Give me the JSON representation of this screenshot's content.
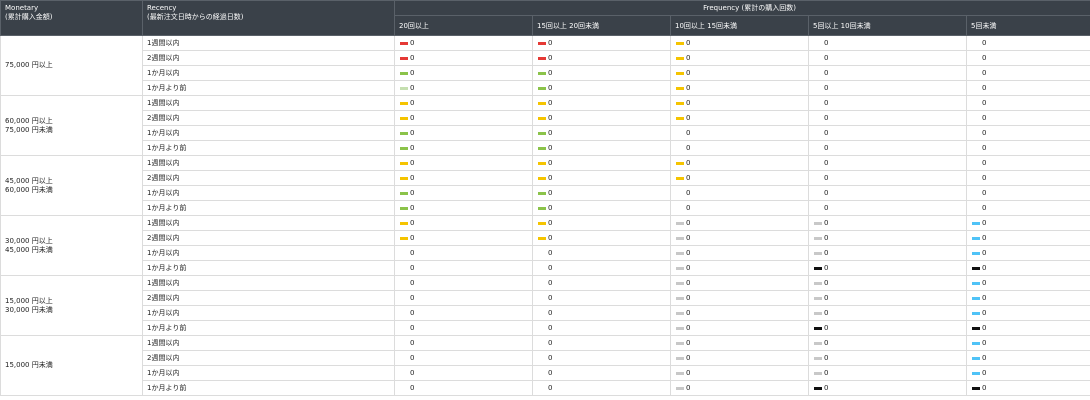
{
  "header": {
    "monetary": "Monetary",
    "monetary_sub": "(累計購入金額)",
    "recency": "Recency",
    "recency_sub": "(最新注文日時からの経過日数)",
    "frequency": "Frequency (累計の購入回数)",
    "bands": [
      "20回以上",
      "15回以上 20回未満",
      "10回以上 15回未満",
      "5回以上 10回未満",
      "5回未満"
    ]
  },
  "recency_labels": [
    "1週間以内",
    "2週間以内",
    "1か月以内",
    "1か月より前"
  ],
  "colors": {
    "red": "#e53935",
    "yellow": "#f5c400",
    "green": "#8bc34a",
    "lightgreen": "#c5dfb0",
    "grey": "#c8c8c8",
    "blue": "#4fc3f7",
    "black": "#111111"
  },
  "groups": [
    {
      "monetary": [
        "75,000 円以上"
      ],
      "rows": [
        {
          "cells": [
            {
              "v": "0",
              "c": "red"
            },
            {
              "v": "0",
              "c": "red"
            },
            {
              "v": "0",
              "c": "yellow"
            },
            {
              "v": "0",
              "c": ""
            },
            {
              "v": "0",
              "c": ""
            }
          ]
        },
        {
          "cells": [
            {
              "v": "0",
              "c": "red"
            },
            {
              "v": "0",
              "c": "red"
            },
            {
              "v": "0",
              "c": "yellow"
            },
            {
              "v": "0",
              "c": ""
            },
            {
              "v": "0",
              "c": ""
            }
          ]
        },
        {
          "cells": [
            {
              "v": "0",
              "c": "green"
            },
            {
              "v": "0",
              "c": "green"
            },
            {
              "v": "0",
              "c": "yellow"
            },
            {
              "v": "0",
              "c": ""
            },
            {
              "v": "0",
              "c": ""
            }
          ]
        },
        {
          "cells": [
            {
              "v": "0",
              "c": "lightgreen"
            },
            {
              "v": "0",
              "c": "green"
            },
            {
              "v": "0",
              "c": "yellow"
            },
            {
              "v": "0",
              "c": ""
            },
            {
              "v": "0",
              "c": ""
            }
          ]
        }
      ]
    },
    {
      "monetary": [
        "60,000 円以上",
        "75,000 円未満"
      ],
      "rows": [
        {
          "cells": [
            {
              "v": "0",
              "c": "yellow"
            },
            {
              "v": "0",
              "c": "yellow"
            },
            {
              "v": "0",
              "c": "yellow"
            },
            {
              "v": "0",
              "c": ""
            },
            {
              "v": "0",
              "c": ""
            }
          ]
        },
        {
          "cells": [
            {
              "v": "0",
              "c": "yellow"
            },
            {
              "v": "0",
              "c": "yellow"
            },
            {
              "v": "0",
              "c": "yellow"
            },
            {
              "v": "0",
              "c": ""
            },
            {
              "v": "0",
              "c": ""
            }
          ]
        },
        {
          "cells": [
            {
              "v": "0",
              "c": "green"
            },
            {
              "v": "0",
              "c": "green"
            },
            {
              "v": "0",
              "c": ""
            },
            {
              "v": "0",
              "c": ""
            },
            {
              "v": "0",
              "c": ""
            }
          ]
        },
        {
          "cells": [
            {
              "v": "0",
              "c": "green"
            },
            {
              "v": "0",
              "c": "green"
            },
            {
              "v": "0",
              "c": ""
            },
            {
              "v": "0",
              "c": ""
            },
            {
              "v": "0",
              "c": ""
            }
          ]
        }
      ]
    },
    {
      "monetary": [
        "45,000 円以上",
        "60,000 円未満"
      ],
      "rows": [
        {
          "cells": [
            {
              "v": "0",
              "c": "yellow"
            },
            {
              "v": "0",
              "c": "yellow"
            },
            {
              "v": "0",
              "c": "yellow"
            },
            {
              "v": "0",
              "c": ""
            },
            {
              "v": "0",
              "c": ""
            }
          ]
        },
        {
          "cells": [
            {
              "v": "0",
              "c": "yellow"
            },
            {
              "v": "0",
              "c": "yellow"
            },
            {
              "v": "0",
              "c": "yellow"
            },
            {
              "v": "0",
              "c": ""
            },
            {
              "v": "0",
              "c": ""
            }
          ]
        },
        {
          "cells": [
            {
              "v": "0",
              "c": "green"
            },
            {
              "v": "0",
              "c": "green"
            },
            {
              "v": "0",
              "c": ""
            },
            {
              "v": "0",
              "c": ""
            },
            {
              "v": "0",
              "c": ""
            }
          ]
        },
        {
          "cells": [
            {
              "v": "0",
              "c": "green"
            },
            {
              "v": "0",
              "c": "green"
            },
            {
              "v": "0",
              "c": ""
            },
            {
              "v": "0",
              "c": ""
            },
            {
              "v": "0",
              "c": ""
            }
          ]
        }
      ]
    },
    {
      "monetary": [
        "30,000 円以上",
        "45,000 円未満"
      ],
      "rows": [
        {
          "cells": [
            {
              "v": "0",
              "c": "yellow"
            },
            {
              "v": "0",
              "c": "yellow"
            },
            {
              "v": "0",
              "c": "grey"
            },
            {
              "v": "0",
              "c": "grey"
            },
            {
              "v": "0",
              "c": "blue"
            }
          ]
        },
        {
          "cells": [
            {
              "v": "0",
              "c": "yellow"
            },
            {
              "v": "0",
              "c": "yellow"
            },
            {
              "v": "0",
              "c": "grey"
            },
            {
              "v": "0",
              "c": "grey"
            },
            {
              "v": "0",
              "c": "blue"
            }
          ]
        },
        {
          "cells": [
            {
              "v": "0",
              "c": ""
            },
            {
              "v": "0",
              "c": ""
            },
            {
              "v": "0",
              "c": "grey"
            },
            {
              "v": "0",
              "c": "grey"
            },
            {
              "v": "0",
              "c": "blue"
            }
          ]
        },
        {
          "cells": [
            {
              "v": "0",
              "c": ""
            },
            {
              "v": "0",
              "c": ""
            },
            {
              "v": "0",
              "c": "grey"
            },
            {
              "v": "0",
              "c": "black"
            },
            {
              "v": "0",
              "c": "black"
            }
          ]
        }
      ]
    },
    {
      "monetary": [
        "15,000 円以上",
        "30,000 円未満"
      ],
      "rows": [
        {
          "cells": [
            {
              "v": "0",
              "c": ""
            },
            {
              "v": "0",
              "c": ""
            },
            {
              "v": "0",
              "c": "grey"
            },
            {
              "v": "0",
              "c": "grey"
            },
            {
              "v": "0",
              "c": "blue"
            }
          ]
        },
        {
          "cells": [
            {
              "v": "0",
              "c": ""
            },
            {
              "v": "0",
              "c": ""
            },
            {
              "v": "0",
              "c": "grey"
            },
            {
              "v": "0",
              "c": "grey"
            },
            {
              "v": "0",
              "c": "blue"
            }
          ]
        },
        {
          "cells": [
            {
              "v": "0",
              "c": ""
            },
            {
              "v": "0",
              "c": ""
            },
            {
              "v": "0",
              "c": "grey"
            },
            {
              "v": "0",
              "c": "grey"
            },
            {
              "v": "0",
              "c": "blue"
            }
          ]
        },
        {
          "cells": [
            {
              "v": "0",
              "c": ""
            },
            {
              "v": "0",
              "c": ""
            },
            {
              "v": "0",
              "c": "grey"
            },
            {
              "v": "0",
              "c": "black"
            },
            {
              "v": "0",
              "c": "black"
            }
          ]
        }
      ]
    },
    {
      "monetary": [
        "15,000 円未満"
      ],
      "rows": [
        {
          "cells": [
            {
              "v": "0",
              "c": ""
            },
            {
              "v": "0",
              "c": ""
            },
            {
              "v": "0",
              "c": "grey"
            },
            {
              "v": "0",
              "c": "grey"
            },
            {
              "v": "0",
              "c": "blue"
            }
          ]
        },
        {
          "cells": [
            {
              "v": "0",
              "c": ""
            },
            {
              "v": "0",
              "c": ""
            },
            {
              "v": "0",
              "c": "grey"
            },
            {
              "v": "0",
              "c": "grey"
            },
            {
              "v": "0",
              "c": "blue"
            }
          ]
        },
        {
          "cells": [
            {
              "v": "0",
              "c": ""
            },
            {
              "v": "0",
              "c": ""
            },
            {
              "v": "0",
              "c": "grey"
            },
            {
              "v": "0",
              "c": "grey"
            },
            {
              "v": "0",
              "c": "blue"
            }
          ]
        },
        {
          "cells": [
            {
              "v": "0",
              "c": ""
            },
            {
              "v": "0",
              "c": ""
            },
            {
              "v": "0",
              "c": "grey"
            },
            {
              "v": "0",
              "c": "black"
            },
            {
              "v": "0",
              "c": "black"
            }
          ]
        }
      ]
    }
  ]
}
